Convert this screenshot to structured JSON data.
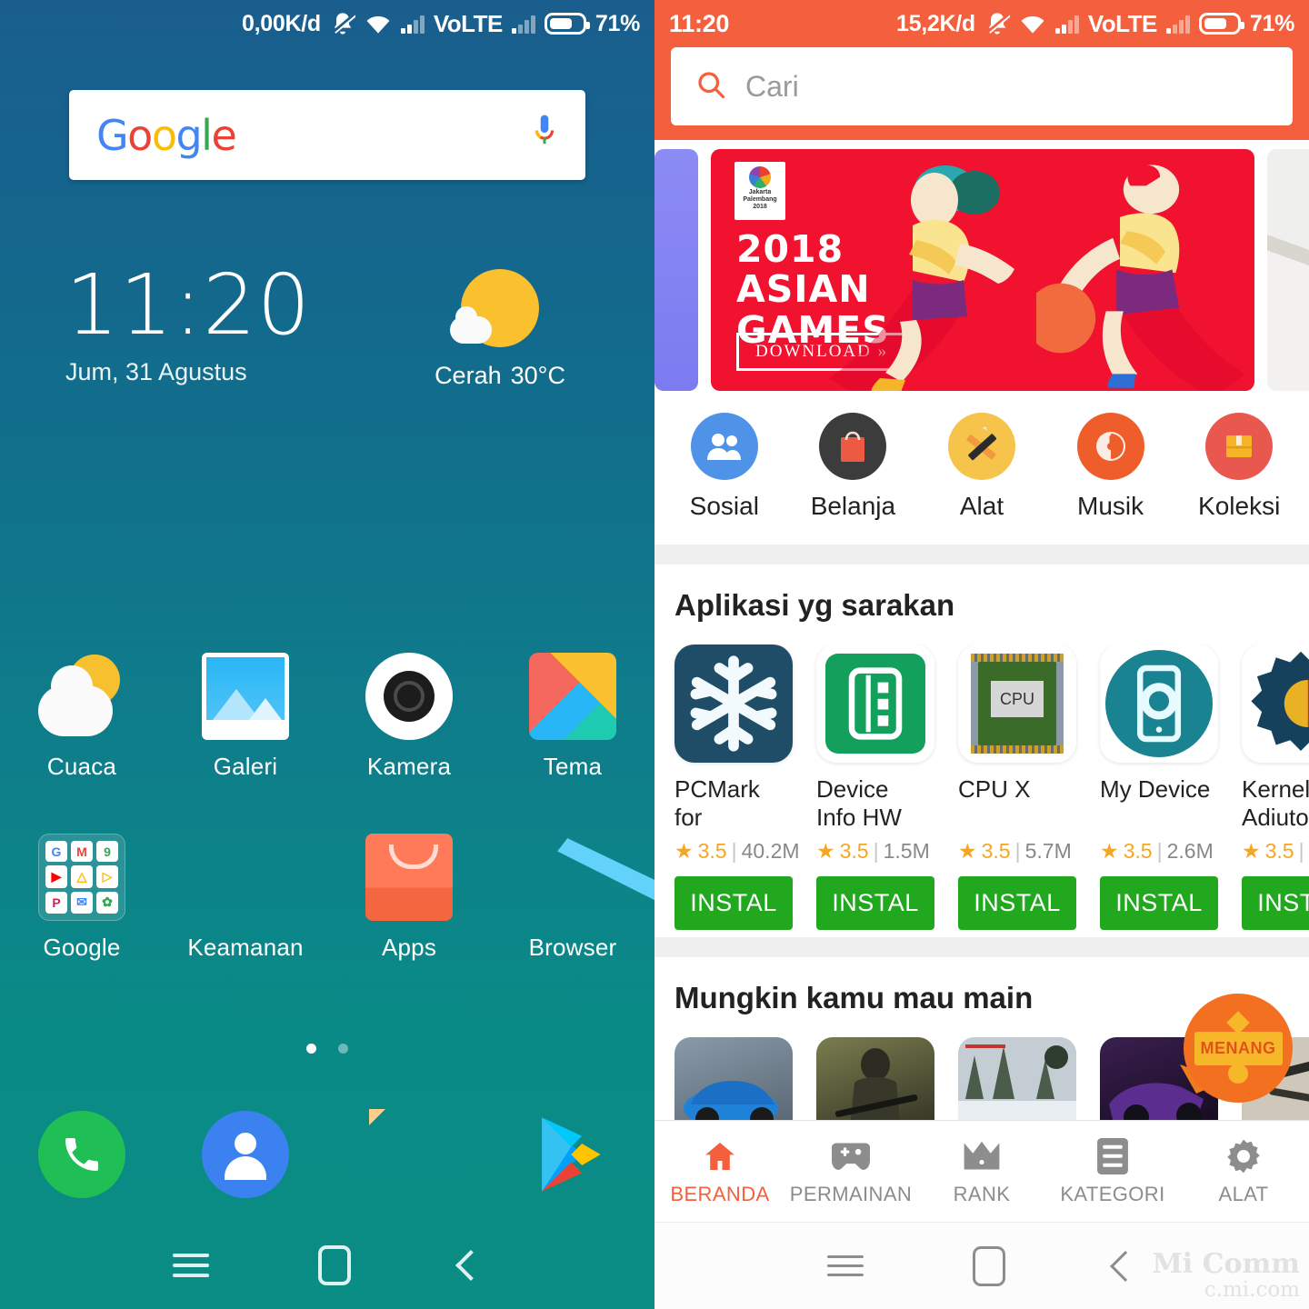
{
  "left_phone": {
    "status_bar": {
      "data_speed": "0,00K/d",
      "battery_percent": "71%",
      "network_label": "VoLTE",
      "icons": [
        "mute-bell-icon",
        "wifi-icon",
        "signal-bars-icon",
        "signal-bars-secondary-icon",
        "battery-icon"
      ]
    },
    "search_widget": {
      "logo_letters": [
        "G",
        "o",
        "o",
        "g",
        "l",
        "e"
      ],
      "mic_icon": "microphone-icon"
    },
    "clock_widget": {
      "time": "11:20",
      "date": "Jum, 31 Agustus",
      "weather_condition": "Cerah",
      "weather_temp": "30°C"
    },
    "app_rows": [
      [
        {
          "label": "Cuaca",
          "icon": "weather-app-icon"
        },
        {
          "label": "Galeri",
          "icon": "gallery-app-icon"
        },
        {
          "label": "Kamera",
          "icon": "camera-app-icon"
        },
        {
          "label": "Tema",
          "icon": "themes-app-icon"
        }
      ],
      [
        {
          "label": "Google",
          "icon": "google-folder-icon"
        },
        {
          "label": "Keamanan",
          "icon": "security-app-icon"
        },
        {
          "label": "Apps",
          "icon": "app-store-icon"
        },
        {
          "label": "Browser",
          "icon": "browser-app-icon"
        }
      ]
    ],
    "google_folder_apps": [
      "G",
      "M",
      "9",
      "▶",
      "△",
      "▷",
      "P",
      "✉",
      "✿"
    ],
    "page_dots": {
      "count": 2,
      "active_index": 0
    },
    "dock": [
      {
        "label": "phone",
        "icon": "phone-dial-icon"
      },
      {
        "label": "contacts",
        "icon": "contacts-icon"
      },
      {
        "label": "messages",
        "icon": "messages-icon"
      },
      {
        "label": "play-store",
        "icon": "google-play-icon"
      }
    ],
    "nav_bar": [
      "menu-icon",
      "home-icon",
      "back-icon"
    ]
  },
  "right_phone": {
    "status_bar": {
      "clock": "11:20",
      "data_speed": "15,2K/d",
      "battery_percent": "71%",
      "network_label": "VoLTE"
    },
    "search": {
      "placeholder": "Cari",
      "icon": "search-icon"
    },
    "banner": {
      "logo_text": "Jakarta\nPalembang\n2018",
      "title_line1": "2018",
      "title_line2": "ASIAN",
      "title_line3": "GAMES",
      "cta": "DOWNLOAD  »"
    },
    "categories": [
      {
        "label": "Sosial",
        "icon": "social-people-icon",
        "color": "#4E93E8"
      },
      {
        "label": "Belanja",
        "icon": "shopping-bag-icon",
        "color": "#3C3C3C"
      },
      {
        "label": "Alat",
        "icon": "tools-pencil-icon",
        "color": "#F6C44A"
      },
      {
        "label": "Musik",
        "icon": "music-disc-icon",
        "color": "#EF5E2A"
      },
      {
        "label": "Koleksi",
        "icon": "collection-box-icon",
        "color": "#E8584F"
      }
    ],
    "apps_section": {
      "title": "Aplikasi yg sarakan",
      "install_label": "INSTAL",
      "apps": [
        {
          "name": "PCMark for Android…",
          "rating": "3.5",
          "size": "40.2M",
          "icon": "snowflake-icon"
        },
        {
          "name": "Device Info HW",
          "rating": "3.5",
          "size": "1.5M",
          "icon": "device-info-icon"
        },
        {
          "name": "CPU X",
          "rating": "3.5",
          "size": "5.7M",
          "icon": "cpu-chip-icon"
        },
        {
          "name": "My Device",
          "rating": "3.5",
          "size": "2.6M",
          "icon": "my-device-icon"
        },
        {
          "name": "Kernel Adiuto",
          "rating": "3.5",
          "size": "",
          "icon": "gear-icon"
        }
      ]
    },
    "games_section": {
      "title": "Mungkin kamu mau main",
      "badge_label": "MENANG",
      "games": [
        "racing-car-game",
        "action-shooter-game",
        "snow-survival-game",
        "neon-racing-game",
        "military-game"
      ]
    },
    "tabs": [
      {
        "label": "BERANDA",
        "icon": "home-icon",
        "active": true
      },
      {
        "label": "PERMAINAN",
        "icon": "gamepad-icon",
        "active": false
      },
      {
        "label": "RANK",
        "icon": "crown-icon",
        "active": false
      },
      {
        "label": "KATEGORI",
        "icon": "list-icon",
        "active": false
      },
      {
        "label": "ALAT",
        "icon": "gear-icon",
        "active": false
      }
    ],
    "nav_bar": [
      "menu-icon",
      "home-icon",
      "back-icon"
    ],
    "watermark": {
      "line1": "Mi Comm",
      "line2": "c.mi.com"
    }
  },
  "colors": {
    "home_top": "#1a5e8e",
    "home_bottom": "#0a8d84",
    "store_accent": "#F4603E",
    "install_green": "#21A81F",
    "banner_red": "#F0122F",
    "rating_gold": "#F5A623"
  }
}
